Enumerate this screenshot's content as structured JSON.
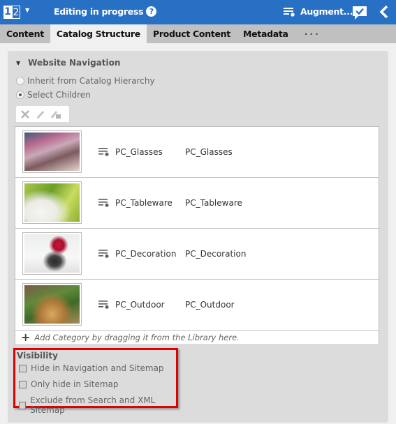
{
  "header": {
    "logo_left": "1",
    "logo_right": "2",
    "status_label": "Editing in progress",
    "help_glyph": "?",
    "augment_label": "Augment...",
    "icons": [
      "logo-dropdown-caret",
      "help-icon",
      "augment-icon",
      "chat-check-icon",
      "back-chevron-icon"
    ]
  },
  "tabs": [
    {
      "label": "Content",
      "active": false
    },
    {
      "label": "Catalog Structure",
      "active": true
    },
    {
      "label": "Product Content",
      "active": false
    },
    {
      "label": "Metadata",
      "active": false
    },
    {
      "label": "···",
      "active": false
    }
  ],
  "website_navigation": {
    "title": "Website Navigation",
    "options": [
      {
        "label": "Inherit from Catalog Hierarchy",
        "checked": false
      },
      {
        "label": "Select Children",
        "checked": true
      }
    ],
    "toolbar_icons": [
      "remove-icon",
      "edit-icon",
      "edit-with-badge-icon"
    ],
    "children": [
      {
        "name": "PC_Glasses",
        "id": "PC_Glasses",
        "thumbnail": "glasses-table-photo"
      },
      {
        "name": "PC_Tableware",
        "id": "PC_Tableware",
        "thumbnail": "white-tableware-photo"
      },
      {
        "name": "PC_Decoration",
        "id": "PC_Decoration",
        "thumbnail": "dining-room-flowers-photo"
      },
      {
        "name": "PC_Outdoor",
        "id": "PC_Outdoor",
        "thumbnail": "picnic-basket-photo"
      }
    ],
    "add_hint": "Add Category by dragging it from the Library here."
  },
  "visibility": {
    "title": "Visibility",
    "options": [
      {
        "label": "Hide in Navigation and Sitemap",
        "checked": false
      },
      {
        "label": "Only hide in Sitemap",
        "checked": false
      },
      {
        "label": "Exclude from Search and XML Sitemap",
        "checked": false
      }
    ]
  },
  "colors": {
    "header_bg": "#2870c4",
    "tabs_bg": "#c0c0c0",
    "panel_bg": "#dcdcdc",
    "highlight_border": "#e00000"
  }
}
